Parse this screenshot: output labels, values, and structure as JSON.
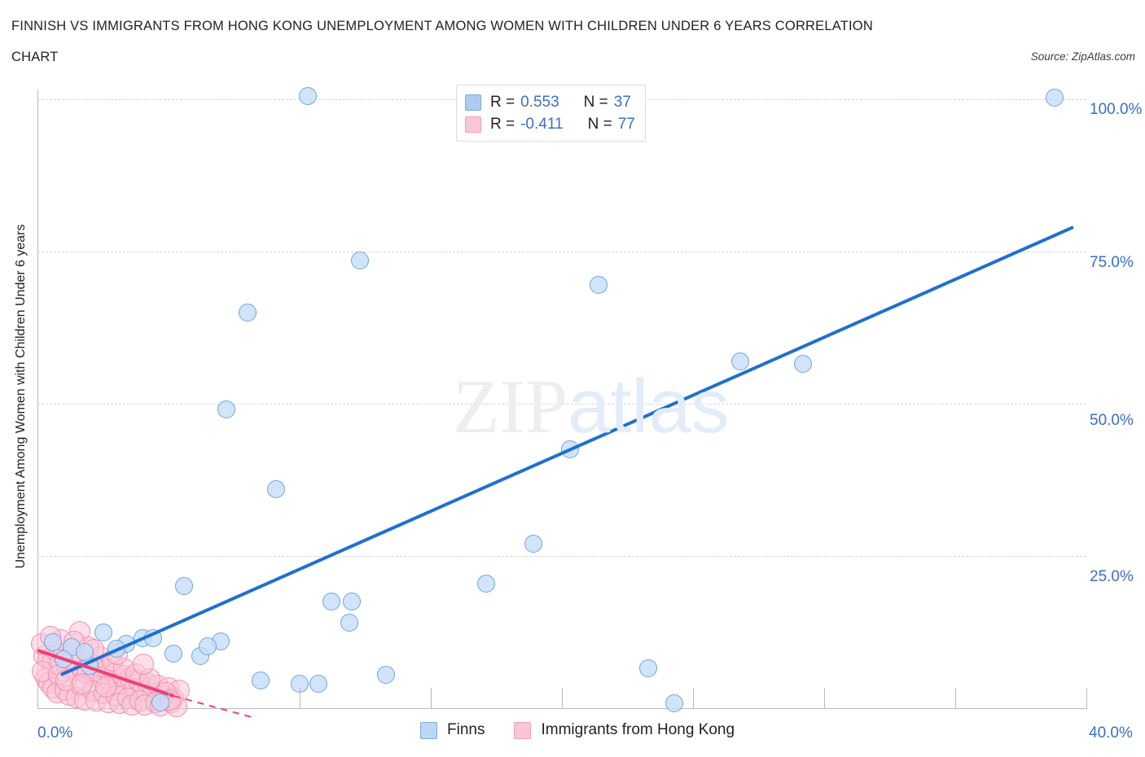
{
  "header": {
    "title_line1": "FINNISH VS IMMIGRANTS FROM HONG KONG UNEMPLOYMENT AMONG WOMEN WITH CHILDREN UNDER 6 YEARS CORRELATION",
    "title_line2": "CHART",
    "source": "Source: ZipAtlas.com"
  },
  "watermark": {
    "part1": "ZIP",
    "part2": "atlas"
  },
  "correlation_legend": {
    "rows": [
      {
        "series": "Finns",
        "color": "#aecbf0",
        "r_label": "R =",
        "r_value": "0.553",
        "n_label": "N =",
        "n_value": "37"
      },
      {
        "series": "Immigrants from Hong Kong",
        "color": "#fac6d6",
        "r_label": "R =",
        "r_value": "-0.411",
        "n_label": "N =",
        "n_value": "77"
      }
    ]
  },
  "series_legend": [
    {
      "label": "Finns",
      "color": "#aecbf0"
    },
    {
      "label": "Immigrants from Hong Kong",
      "color": "#fac6d6"
    }
  ],
  "axes": {
    "y_title": "Unemployment Among Women with Children Under 6 years",
    "y_ticks": [
      "100.0%",
      "75.0%",
      "50.0%",
      "25.0%"
    ],
    "x_min_label": "0.0%",
    "x_max_label": "40.0%"
  },
  "chart_data": {
    "type": "scatter",
    "title": "FINNISH VS IMMIGRANTS FROM HONG KONG UNEMPLOYMENT AMONG WOMEN WITH CHILDREN UNDER 6 YEARS CORRELATION CHART",
    "xlabel": "",
    "ylabel": "Unemployment Among Women with Children Under 6 years",
    "xlim": [
      0,
      40
    ],
    "ylim": [
      0,
      105
    ],
    "x_unit": "%",
    "y_unit": "%",
    "grid": true,
    "gridlines_y": [
      25,
      50,
      75,
      100
    ],
    "legend_position": "bottom-center",
    "series": [
      {
        "name": "Finns",
        "color": "#aecbf0",
        "r": 0.553,
        "n": 37,
        "trendline": {
          "type": "linear",
          "color": "#1f6fd0",
          "x_start": 0.9,
          "y_start": 5.5,
          "x_end": 39.5,
          "y_end": 79.0
        },
        "points": [
          {
            "x": 10.3,
            "y": 100.5
          },
          {
            "x": 38.8,
            "y": 100.3
          },
          {
            "x": 12.3,
            "y": 73.5
          },
          {
            "x": 21.4,
            "y": 69.5
          },
          {
            "x": 8.0,
            "y": 65.0
          },
          {
            "x": 26.8,
            "y": 57.0
          },
          {
            "x": 29.2,
            "y": 56.5
          },
          {
            "x": 7.2,
            "y": 49.0
          },
          {
            "x": 20.3,
            "y": 42.5
          },
          {
            "x": 9.1,
            "y": 36.0
          },
          {
            "x": 18.9,
            "y": 27.0
          },
          {
            "x": 17.1,
            "y": 20.5
          },
          {
            "x": 5.6,
            "y": 20.0
          },
          {
            "x": 11.2,
            "y": 17.5
          },
          {
            "x": 12.0,
            "y": 17.5
          },
          {
            "x": 11.9,
            "y": 14.0
          },
          {
            "x": 2.5,
            "y": 12.5
          },
          {
            "x": 4.0,
            "y": 11.5
          },
          {
            "x": 4.4,
            "y": 11.5
          },
          {
            "x": 7.0,
            "y": 11.0
          },
          {
            "x": 3.4,
            "y": 10.5
          },
          {
            "x": 1.3,
            "y": 10.0
          },
          {
            "x": 5.2,
            "y": 9.0
          },
          {
            "x": 6.2,
            "y": 8.5
          },
          {
            "x": 1.0,
            "y": 8.0
          },
          {
            "x": 23.3,
            "y": 6.5
          },
          {
            "x": 13.3,
            "y": 5.5
          },
          {
            "x": 8.5,
            "y": 4.5
          },
          {
            "x": 10.0,
            "y": 4.0
          },
          {
            "x": 10.7,
            "y": 4.0
          },
          {
            "x": 0.6,
            "y": 10.8
          },
          {
            "x": 3.0,
            "y": 9.8
          },
          {
            "x": 2.0,
            "y": 7.0
          },
          {
            "x": 4.7,
            "y": 1.0
          },
          {
            "x": 24.3,
            "y": 0.8
          },
          {
            "x": 6.5,
            "y": 10.2
          },
          {
            "x": 1.8,
            "y": 9.2
          }
        ]
      },
      {
        "name": "Immigrants from Hong Kong",
        "color": "#fac6d6",
        "r": -0.411,
        "n": 77,
        "trendline": {
          "type": "linear",
          "color": "#ec407a",
          "x_start": 0.0,
          "y_start": 9.5,
          "x_end": 5.2,
          "y_end": 2.0,
          "dashed_extension": {
            "x_end": 8.2,
            "y_end": -1.5
          }
        },
        "points": [
          {
            "x": 0.25,
            "y": 8.6
          },
          {
            "x": 0.4,
            "y": 8.0
          },
          {
            "x": 0.55,
            "y": 7.6
          },
          {
            "x": 0.7,
            "y": 9.4
          },
          {
            "x": 0.85,
            "y": 7.2
          },
          {
            "x": 1.0,
            "y": 8.8
          },
          {
            "x": 1.15,
            "y": 6.6
          },
          {
            "x": 1.3,
            "y": 7.8
          },
          {
            "x": 1.45,
            "y": 6.2
          },
          {
            "x": 1.6,
            "y": 12.6
          },
          {
            "x": 1.75,
            "y": 6.0
          },
          {
            "x": 1.9,
            "y": 5.6
          },
          {
            "x": 2.05,
            "y": 7.4
          },
          {
            "x": 2.2,
            "y": 5.2
          },
          {
            "x": 2.35,
            "y": 6.8
          },
          {
            "x": 2.5,
            "y": 4.8
          },
          {
            "x": 2.65,
            "y": 6.4
          },
          {
            "x": 2.8,
            "y": 4.4
          },
          {
            "x": 2.95,
            "y": 5.8
          },
          {
            "x": 3.1,
            "y": 4.0
          },
          {
            "x": 3.25,
            "y": 5.4
          },
          {
            "x": 3.4,
            "y": 3.6
          },
          {
            "x": 3.55,
            "y": 5.0
          },
          {
            "x": 3.7,
            "y": 3.2
          },
          {
            "x": 3.85,
            "y": 4.6
          },
          {
            "x": 4.0,
            "y": 2.8
          },
          {
            "x": 4.2,
            "y": 4.2
          },
          {
            "x": 4.4,
            "y": 2.4
          },
          {
            "x": 4.6,
            "y": 3.8
          },
          {
            "x": 4.8,
            "y": 2.0
          },
          {
            "x": 5.0,
            "y": 3.4
          },
          {
            "x": 5.2,
            "y": 1.6
          },
          {
            "x": 5.4,
            "y": 3.0
          },
          {
            "x": 0.15,
            "y": 10.5
          },
          {
            "x": 0.3,
            "y": 5.0
          },
          {
            "x": 0.45,
            "y": 4.2
          },
          {
            "x": 0.6,
            "y": 3.4
          },
          {
            "x": 0.75,
            "y": 2.6
          },
          {
            "x": 0.9,
            "y": 11.2
          },
          {
            "x": 1.05,
            "y": 3.0
          },
          {
            "x": 1.2,
            "y": 2.2
          },
          {
            "x": 1.35,
            "y": 9.0
          },
          {
            "x": 1.5,
            "y": 1.8
          },
          {
            "x": 1.65,
            "y": 3.8
          },
          {
            "x": 1.8,
            "y": 1.4
          },
          {
            "x": 1.95,
            "y": 10.0
          },
          {
            "x": 2.1,
            "y": 2.8
          },
          {
            "x": 2.25,
            "y": 1.2
          },
          {
            "x": 2.4,
            "y": 8.4
          },
          {
            "x": 2.55,
            "y": 2.4
          },
          {
            "x": 2.7,
            "y": 1.0
          },
          {
            "x": 2.85,
            "y": 7.8
          },
          {
            "x": 3.0,
            "y": 2.0
          },
          {
            "x": 3.15,
            "y": 0.8
          },
          {
            "x": 3.3,
            "y": 6.6
          },
          {
            "x": 3.45,
            "y": 1.6
          },
          {
            "x": 3.6,
            "y": 0.6
          },
          {
            "x": 3.75,
            "y": 5.6
          },
          {
            "x": 3.9,
            "y": 1.2
          },
          {
            "x": 4.1,
            "y": 0.5
          },
          {
            "x": 4.3,
            "y": 4.8
          },
          {
            "x": 4.5,
            "y": 1.0
          },
          {
            "x": 4.7,
            "y": 0.4
          },
          {
            "x": 4.9,
            "y": 2.6
          },
          {
            "x": 5.1,
            "y": 0.9
          },
          {
            "x": 5.3,
            "y": 0.3
          },
          {
            "x": 0.2,
            "y": 6.0
          },
          {
            "x": 0.5,
            "y": 11.8
          },
          {
            "x": 0.8,
            "y": 5.5
          },
          {
            "x": 1.1,
            "y": 4.5
          },
          {
            "x": 1.4,
            "y": 11.0
          },
          {
            "x": 1.7,
            "y": 4.0
          },
          {
            "x": 2.15,
            "y": 9.6
          },
          {
            "x": 2.6,
            "y": 3.5
          },
          {
            "x": 3.05,
            "y": 8.8
          },
          {
            "x": 4.05,
            "y": 7.2
          },
          {
            "x": 5.05,
            "y": 1.4
          }
        ]
      }
    ]
  }
}
